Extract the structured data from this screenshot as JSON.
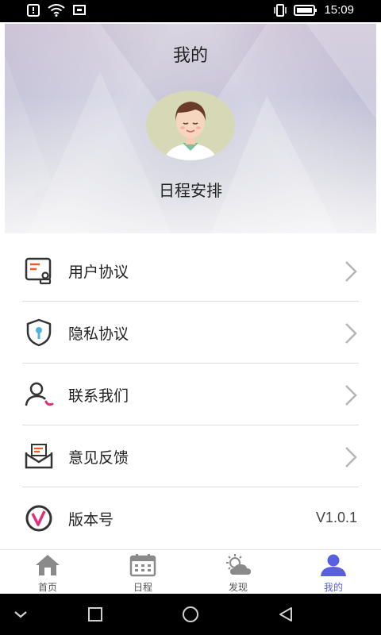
{
  "status_bar": {
    "time": "15:09",
    "icons_left": [
      "alert-icon",
      "wifi-icon",
      "screenshot-icon"
    ],
    "icons_right": [
      "vibrate-icon",
      "battery-icon"
    ]
  },
  "header": {
    "title": "我的",
    "user_name": "日程安排"
  },
  "menu": {
    "items": [
      {
        "label": "用户协议",
        "icon": "user-agreement-icon"
      },
      {
        "label": "隐私协议",
        "icon": "privacy-shield-icon"
      },
      {
        "label": "联系我们",
        "icon": "contact-icon"
      },
      {
        "label": "意见反馈",
        "icon": "feedback-mail-icon"
      },
      {
        "label": "版本号",
        "icon": "version-logo-icon",
        "value": "V1.0.1"
      }
    ]
  },
  "tabbar": {
    "tabs": [
      {
        "label": "首页",
        "icon": "home-icon"
      },
      {
        "label": "日程",
        "icon": "calendar-icon"
      },
      {
        "label": "发现",
        "icon": "weather-icon"
      },
      {
        "label": "我的",
        "icon": "profile-icon"
      }
    ],
    "active_index": 3
  },
  "colors": {
    "accent": "#5a5fe0",
    "icon_orange": "#f05a28",
    "icon_dark": "#333333"
  }
}
